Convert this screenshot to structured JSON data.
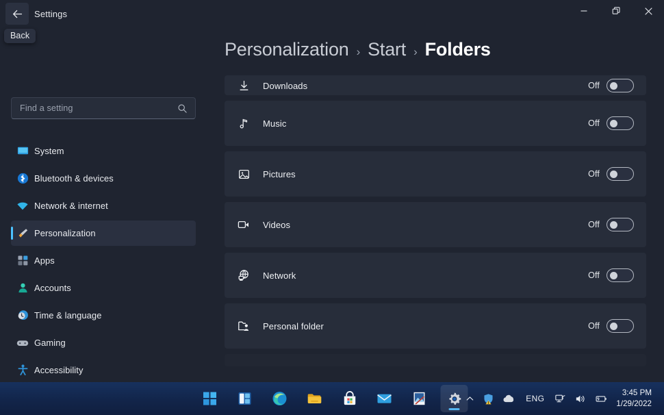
{
  "window": {
    "title": "Settings",
    "back_tooltip": "Back",
    "back_icon": "back-arrow-icon",
    "controls": {
      "minimize": "minimize-icon",
      "maximize": "restore-icon",
      "close": "close-icon"
    }
  },
  "search": {
    "placeholder": "Find a setting",
    "icon": "search-icon"
  },
  "sidebar": {
    "items": [
      {
        "label": "System",
        "icon": "monitor-icon",
        "selected": false
      },
      {
        "label": "Bluetooth & devices",
        "icon": "bluetooth-icon",
        "selected": false
      },
      {
        "label": "Network & internet",
        "icon": "wifi-icon",
        "selected": false
      },
      {
        "label": "Personalization",
        "icon": "paintbrush-icon",
        "selected": true
      },
      {
        "label": "Apps",
        "icon": "apps-grid-icon",
        "selected": false
      },
      {
        "label": "Accounts",
        "icon": "person-icon",
        "selected": false
      },
      {
        "label": "Time & language",
        "icon": "clock-globe-icon",
        "selected": false
      },
      {
        "label": "Gaming",
        "icon": "gamepad-icon",
        "selected": false
      },
      {
        "label": "Accessibility",
        "icon": "accessibility-icon",
        "selected": false
      }
    ]
  },
  "breadcrumb": {
    "items": [
      "Personalization",
      "Start",
      "Folders"
    ],
    "separator": "›",
    "current_index": 2
  },
  "folders": {
    "rows": [
      {
        "label": "Downloads",
        "icon": "download-icon",
        "state": "Off",
        "clipped": true
      },
      {
        "label": "Music",
        "icon": "music-note-icon",
        "state": "Off",
        "clipped": false
      },
      {
        "label": "Pictures",
        "icon": "picture-icon",
        "state": "Off",
        "clipped": false
      },
      {
        "label": "Videos",
        "icon": "video-camera-icon",
        "state": "Off",
        "clipped": false
      },
      {
        "label": "Network",
        "icon": "network-globe-icon",
        "state": "Off",
        "clipped": false
      },
      {
        "label": "Personal folder",
        "icon": "personal-folder-icon",
        "state": "Off",
        "clipped": false
      }
    ]
  },
  "taskbar": {
    "apps": [
      {
        "name": "start-button",
        "active": false
      },
      {
        "name": "widgets-button",
        "active": false
      },
      {
        "name": "edge-button",
        "active": false
      },
      {
        "name": "file-explorer-button",
        "active": false
      },
      {
        "name": "microsoft-store-button",
        "active": false
      },
      {
        "name": "mail-button",
        "active": false
      },
      {
        "name": "photos-button",
        "active": false
      },
      {
        "name": "settings-button",
        "active": true
      }
    ],
    "tray": {
      "overflow_icon": "chevron-up-icon",
      "defender_icon": "shield-warning-icon",
      "onedrive_icon": "cloud-icon",
      "language": "ENG",
      "network_icon": "network-icon",
      "volume_icon": "speaker-icon",
      "battery_icon": "battery-charging-icon"
    },
    "clock": {
      "time": "3:45 PM",
      "date": "1/29/2022"
    }
  },
  "colors": {
    "accent": "#4cc2ff",
    "window_bg": "#1f2430",
    "card_bg": "#272d3a",
    "taskbar_bg": "#12254a"
  }
}
